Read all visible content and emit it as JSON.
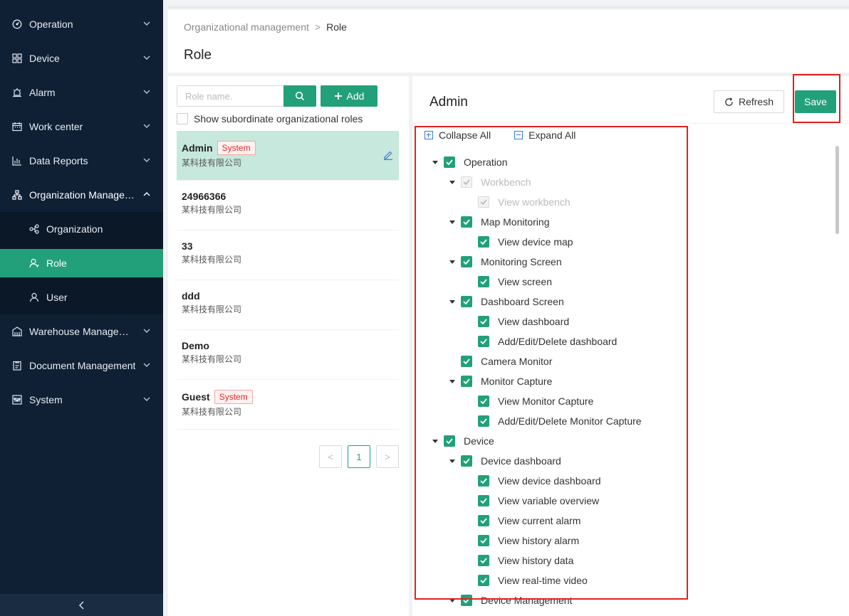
{
  "sidebar": {
    "items": [
      {
        "label": "Operation",
        "icon": "dashboard-gauge-icon"
      },
      {
        "label": "Device",
        "icon": "grid-icon"
      },
      {
        "label": "Alarm",
        "icon": "alarm-bell-icon"
      },
      {
        "label": "Work center",
        "icon": "calendar-icon"
      },
      {
        "label": "Data Reports",
        "icon": "bar-chart-icon"
      },
      {
        "label": "Organization Manageme...",
        "icon": "org-tree-icon"
      },
      {
        "label": "Warehouse Manageme...",
        "icon": "warehouse-icon"
      },
      {
        "label": "Document Management",
        "icon": "document-icon"
      },
      {
        "label": "System",
        "icon": "system-settings-icon"
      }
    ],
    "sub_items": [
      {
        "label": "Organization",
        "icon": "organization-icon"
      },
      {
        "label": "Role",
        "icon": "role-icon"
      },
      {
        "label": "User",
        "icon": "user-icon"
      }
    ]
  },
  "header": {
    "breadcrumb_parent": "Organizational management",
    "breadcrumb_sep": ">",
    "breadcrumb_current": "Role",
    "title": "Role"
  },
  "left_panel": {
    "search_placeholder": "Role name.",
    "add_label": "Add",
    "show_subordinate_label": "Show subordinate organizational roles",
    "roles": [
      {
        "name": "Admin",
        "badge": "System",
        "org": "某科技有限公司"
      },
      {
        "name": "24966366",
        "badge": "",
        "org": "某科技有限公司"
      },
      {
        "name": "33",
        "badge": "",
        "org": "某科技有限公司"
      },
      {
        "name": "ddd",
        "badge": "",
        "org": "某科技有限公司"
      },
      {
        "name": "Demo",
        "badge": "",
        "org": "某科技有限公司"
      },
      {
        "name": "Guest",
        "badge": "System",
        "org": "某科技有限公司"
      }
    ],
    "pagination": {
      "prev": "<",
      "current": "1",
      "next": ">"
    }
  },
  "right_panel": {
    "role_title": "Admin",
    "refresh_label": "Refresh",
    "save_label": "Save",
    "collapse_all": "Collapse All",
    "expand_all": "Expand All",
    "tree": [
      {
        "label": "Operation",
        "level": 0,
        "expanded": true,
        "checked": true,
        "disabled": false
      },
      {
        "label": "Workbench",
        "level": 1,
        "expanded": true,
        "checked": true,
        "disabled": true
      },
      {
        "label": "View workbench",
        "level": 2,
        "checked": true,
        "disabled": true
      },
      {
        "label": "Map Monitoring",
        "level": 1,
        "expanded": true,
        "checked": true,
        "disabled": false
      },
      {
        "label": "View device map",
        "level": 2,
        "checked": true,
        "disabled": false
      },
      {
        "label": "Monitoring Screen",
        "level": 1,
        "expanded": true,
        "checked": true,
        "disabled": false
      },
      {
        "label": "View screen",
        "level": 2,
        "checked": true,
        "disabled": false
      },
      {
        "label": "Dashboard Screen",
        "level": 1,
        "expanded": true,
        "checked": true,
        "disabled": false
      },
      {
        "label": "View dashboard",
        "level": 2,
        "checked": true,
        "disabled": false
      },
      {
        "label": "Add/Edit/Delete dashboard",
        "level": 2,
        "checked": true,
        "disabled": false
      },
      {
        "label": "Camera Monitor",
        "level": 1,
        "checked": true,
        "disabled": false
      },
      {
        "label": "Monitor Capture",
        "level": 1,
        "expanded": true,
        "checked": true,
        "disabled": false
      },
      {
        "label": "View Monitor Capture",
        "level": 2,
        "checked": true,
        "disabled": false
      },
      {
        "label": "Add/Edit/Delete Monitor Capture",
        "level": 2,
        "checked": true,
        "disabled": false
      },
      {
        "label": "Device",
        "level": 0,
        "expanded": true,
        "checked": true,
        "disabled": false
      },
      {
        "label": "Device dashboard",
        "level": 1,
        "expanded": true,
        "checked": true,
        "disabled": false
      },
      {
        "label": "View device dashboard",
        "level": 2,
        "checked": true,
        "disabled": false
      },
      {
        "label": "View variable overview",
        "level": 2,
        "checked": true,
        "disabled": false
      },
      {
        "label": "View current alarm",
        "level": 2,
        "checked": true,
        "disabled": false
      },
      {
        "label": "View history alarm",
        "level": 2,
        "checked": true,
        "disabled": false
      },
      {
        "label": "View history data",
        "level": 2,
        "checked": true,
        "disabled": false
      },
      {
        "label": "View real-time video",
        "level": 2,
        "checked": true,
        "disabled": false
      },
      {
        "label": "Device Management",
        "level": 1,
        "expanded": true,
        "checked": true,
        "disabled": false
      }
    ]
  },
  "colors": {
    "accent": "#22a07a",
    "sidebar_bg": "#0f2035",
    "highlight": "#e02020",
    "badge": "#e02a2a"
  }
}
